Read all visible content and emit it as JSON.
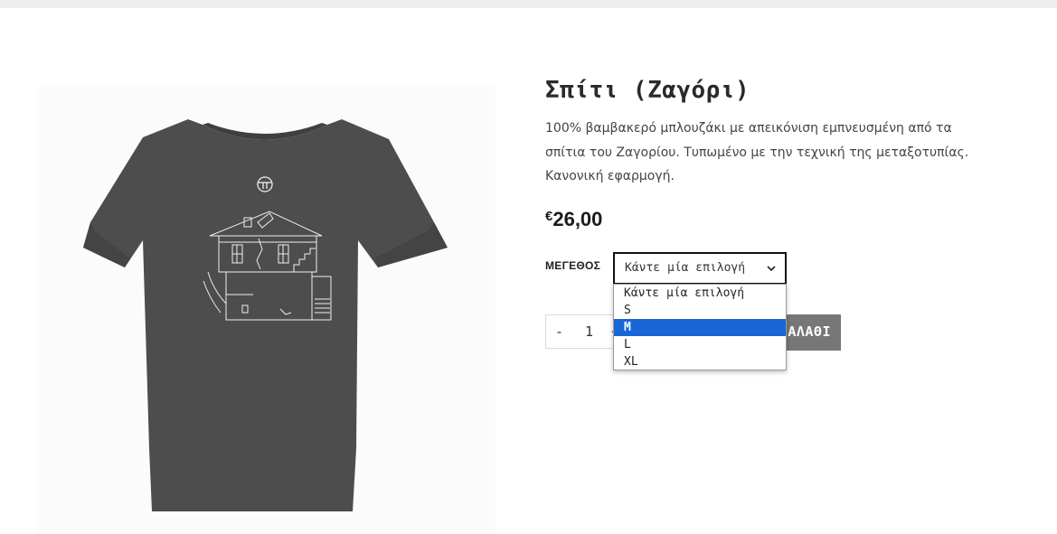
{
  "product": {
    "title": "Σπίτι (Ζαγόρι)",
    "description": "100% βαμβακερό μπλουζάκι με απεικόνιση εμπνευσμένη από τα σπίτια του Ζαγορίου. Τυπωμένο με την τεχνική της μεταξοτυπίας. Κανονική εφαρμογή.",
    "price_currency": "€",
    "price_value": "26,00",
    "image_icon": "tshirt-house-print"
  },
  "variation": {
    "label": "ΜΕΓΕΘΟΣ",
    "selected_text": "Κάντε μία επιλογή",
    "options": [
      "Κάντε μία επιλογή",
      "S",
      "M",
      "L",
      "XL"
    ],
    "highlighted_option": "M",
    "chevron_icon": "chevron-down-icon"
  },
  "quantity": {
    "minus": "-",
    "value": "1",
    "plus": "+"
  },
  "cart": {
    "button_label_visible": "ΑΛΑΘΙ"
  },
  "colors": {
    "tshirt": "#4d4d4d",
    "button": "#777777",
    "highlight": "#1a66d6"
  }
}
